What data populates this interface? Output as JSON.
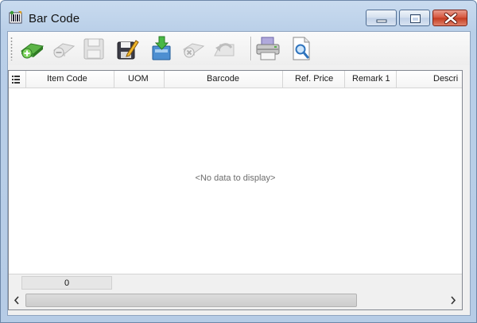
{
  "window": {
    "title": "Bar Code"
  },
  "toolbar": {
    "buttons": [
      {
        "icon": "add-icon",
        "enabled": true
      },
      {
        "icon": "remove-icon",
        "enabled": false
      },
      {
        "icon": "save-icon",
        "enabled": false
      },
      {
        "icon": "edit-icon",
        "enabled": true
      },
      {
        "icon": "import-icon",
        "enabled": true
      },
      {
        "icon": "cancel-icon",
        "enabled": false
      },
      {
        "icon": "undo-icon",
        "enabled": false
      },
      {
        "icon": "print-icon",
        "enabled": true
      },
      {
        "icon": "preview-icon",
        "enabled": true
      }
    ]
  },
  "grid": {
    "columns": [
      "Item Code",
      "UOM",
      "Barcode",
      "Ref. Price",
      "Remark 1",
      "Descri"
    ],
    "empty_text": "<No data to display>",
    "footer_count": "0"
  },
  "colors": {
    "titlebar": "#c9dbef",
    "close_button": "#c33a1f",
    "grid_border": "#828790"
  }
}
